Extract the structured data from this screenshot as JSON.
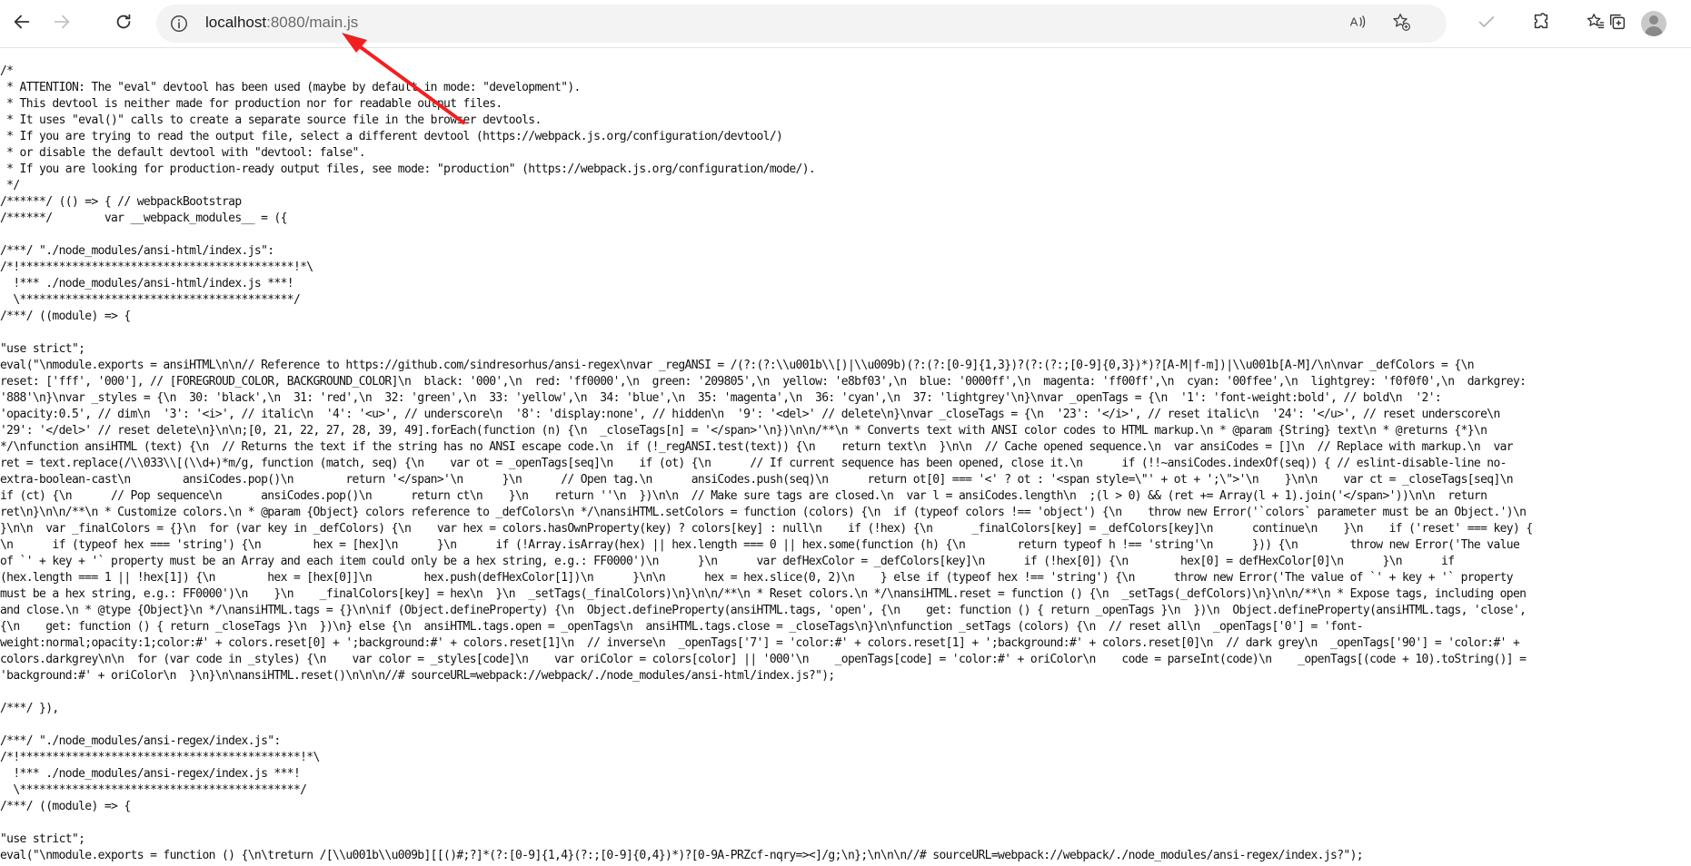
{
  "browser": {
    "url_host": "localhost",
    "url_rest": ":8080/main.js",
    "icons": {
      "back": "arrow-left-icon",
      "forward": "arrow-right-icon",
      "reload": "reload-icon",
      "info": "info-icon",
      "read_aloud": "read-aloud-icon",
      "add_favorite": "add-favorite-icon",
      "check": "check-icon",
      "extensions": "puzzle-icon",
      "favorites": "favorites-icon",
      "collections": "collections-icon",
      "profile": "profile-icon"
    },
    "annotation_color": "#f02020"
  },
  "source_lines": [
    "/*",
    " * ATTENTION: The \"eval\" devtool has been used (maybe by default in mode: \"development\").",
    " * This devtool is neither made for production nor for readable output files.",
    " * It uses \"eval()\" calls to create a separate source file in the browser devtools.",
    " * If you are trying to read the output file, select a different devtool (https://webpack.js.org/configuration/devtool/)",
    " * or disable the default devtool with \"devtool: false\".",
    " * If you are looking for production-ready output files, see mode: \"production\" (https://webpack.js.org/configuration/mode/).",
    " */",
    "/******/ (() => { // webpackBootstrap",
    "/******/        var __webpack_modules__ = ({",
    "",
    "/***/ \"./node_modules/ansi-html/index.js\":",
    "/*!******************************************!*\\",
    "  !*** ./node_modules/ansi-html/index.js ***!",
    "  \\******************************************/",
    "/***/ ((module) => {",
    "",
    "\"use strict\";",
    "eval(\"\\nmodule.exports = ansiHTML\\n\\n// Reference to https://github.com/sindresorhus/ansi-regex\\nvar _regANSI = /(?:(?:\\\\u001b\\\\[)|\\\\u009b)(?:(?:[0-9]{1,3})?(?:(?:;[0-9]{0,3})*)?[A-M|f-m])|\\\\u001b[A-M]/\\n\\nvar _defColors = {\\n",
    "reset: ['fff', '000'], // [FOREGROUD_COLOR, BACKGROUND_COLOR]\\n  black: '000',\\n  red: 'ff0000',\\n  green: '209805',\\n  yellow: 'e8bf03',\\n  blue: '0000ff',\\n  magenta: 'ff00ff',\\n  cyan: '00ffee',\\n  lightgrey: 'f0f0f0',\\n  darkgrey:",
    "'888'\\n}\\nvar _styles = {\\n  30: 'black',\\n  31: 'red',\\n  32: 'green',\\n  33: 'yellow',\\n  34: 'blue',\\n  35: 'magenta',\\n  36: 'cyan',\\n  37: 'lightgrey'\\n}\\nvar _openTags = {\\n  '1': 'font-weight:bold', // bold\\n  '2':",
    "'opacity:0.5', // dim\\n  '3': '<i>', // italic\\n  '4': '<u>', // underscore\\n  '8': 'display:none', // hidden\\n  '9': '<del>' // delete\\n}\\nvar _closeTags = {\\n  '23': '</i>', // reset italic\\n  '24': '</u>', // reset underscore\\n",
    "'29': '</del>' // reset delete\\n}\\n\\n;[0, 21, 22, 27, 28, 39, 49].forEach(function (n) {\\n  _closeTags[n] = '</span>'\\n})\\n\\n/**\\n * Converts text with ANSI color codes to HTML markup.\\n * @param {String} text\\n * @returns {*}\\n",
    "*/\\nfunction ansiHTML (text) {\\n  // Returns the text if the string has no ANSI escape code.\\n  if (!_regANSI.test(text)) {\\n    return text\\n  }\\n\\n  // Cache opened sequence.\\n  var ansiCodes = []\\n  // Replace with markup.\\n  var",
    "ret = text.replace(/\\\\033\\\\[(\\\\d+)*m/g, function (match, seq) {\\n    var ot = _openTags[seq]\\n    if (ot) {\\n      // If current sequence has been opened, close it.\\n      if (!!~ansiCodes.indexOf(seq)) { // eslint-disable-line no-",
    "extra-boolean-cast\\n        ansiCodes.pop()\\n        return '</span>'\\n      }\\n      // Open tag.\\n      ansiCodes.push(seq)\\n      return ot[0] === '<' ? ot : '<span style=\\\"' + ot + ';\\\">'\\n    }\\n\\n    var ct = _closeTags[seq]\\n",
    "if (ct) {\\n      // Pop sequence\\n      ansiCodes.pop()\\n      return ct\\n    }\\n    return ''\\n  })\\n\\n  // Make sure tags are closed.\\n  var l = ansiCodes.length\\n  ;(l > 0) && (ret += Array(l + 1).join('</span>'))\\n\\n  return",
    "ret\\n}\\n\\n/**\\n * Customize colors.\\n * @param {Object} colors reference to _defColors\\n */\\nansiHTML.setColors = function (colors) {\\n  if (typeof colors !== 'object') {\\n    throw new Error('`colors` parameter must be an Object.')\\n",
    "}\\n\\n  var _finalColors = {}\\n  for (var key in _defColors) {\\n    var hex = colors.hasOwnProperty(key) ? colors[key] : null\\n    if (!hex) {\\n      _finalColors[key] = _defColors[key]\\n      continue\\n    }\\n    if ('reset' === key) {",
    "\\n      if (typeof hex === 'string') {\\n        hex = [hex]\\n      }\\n      if (!Array.isArray(hex) || hex.length === 0 || hex.some(function (h) {\\n        return typeof h !== 'string'\\n      })) {\\n        throw new Error('The value",
    "of `' + key + '` property must be an Array and each item could only be a hex string, e.g.: FF0000')\\n      }\\n      var defHexColor = _defColors[key]\\n      if (!hex[0]) {\\n        hex[0] = defHexColor[0]\\n      }\\n      if",
    "(hex.length === 1 || !hex[1]) {\\n        hex = [hex[0]]\\n        hex.push(defHexColor[1])\\n      }\\n\\n      hex = hex.slice(0, 2)\\n    } else if (typeof hex !== 'string') {\\n      throw new Error('The value of `' + key + '` property",
    "must be a hex string, e.g.: FF0000')\\n    }\\n    _finalColors[key] = hex\\n  }\\n  _setTags(_finalColors)\\n}\\n\\n/**\\n * Reset colors.\\n */\\nansiHTML.reset = function () {\\n  _setTags(_defColors)\\n}\\n\\n/**\\n * Expose tags, including open",
    "and close.\\n * @type {Object}\\n */\\nansiHTML.tags = {}\\n\\nif (Object.defineProperty) {\\n  Object.defineProperty(ansiHTML.tags, 'open', {\\n    get: function () { return _openTags }\\n  })\\n  Object.defineProperty(ansiHTML.tags, 'close',",
    "{\\n    get: function () { return _closeTags }\\n  })\\n} else {\\n  ansiHTML.tags.open = _openTags\\n  ansiHTML.tags.close = _closeTags\\n}\\n\\nfunction _setTags (colors) {\\n  // reset all\\n  _openTags['0'] = 'font-",
    "weight:normal;opacity:1;color:#' + colors.reset[0] + ';background:#' + colors.reset[1]\\n  // inverse\\n  _openTags['7'] = 'color:#' + colors.reset[1] + ';background:#' + colors.reset[0]\\n  // dark grey\\n  _openTags['90'] = 'color:#' +",
    "colors.darkgrey\\n\\n  for (var code in _styles) {\\n    var color = _styles[code]\\n    var oriColor = colors[color] || '000'\\n    _openTags[code] = 'color:#' + oriColor\\n    code = parseInt(code)\\n    _openTags[(code + 10).toString()] =",
    "'background:#' + oriColor\\n  }\\n}\\n\\nansiHTML.reset()\\n\\n\\n//# sourceURL=webpack://webpack/./node_modules/ansi-html/index.js?\");",
    "",
    "/***/ }),",
    "",
    "/***/ \"./node_modules/ansi-regex/index.js\":",
    "/*!*******************************************!*\\",
    "  !*** ./node_modules/ansi-regex/index.js ***!",
    "  \\*******************************************/",
    "/***/ ((module) => {",
    "",
    "\"use strict\";",
    "eval(\"\\nmodule.exports = function () {\\n\\treturn /[\\\\u001b\\\\u009b][[()#;?]*(?:[0-9]{1,4}(?:;[0-9]{0,4})*)?[0-9A-PRZcf-nqry=><]/g;\\n};\\n\\n\\n//# sourceURL=webpack://webpack/./node_modules/ansi-regex/index.js?\");"
  ]
}
